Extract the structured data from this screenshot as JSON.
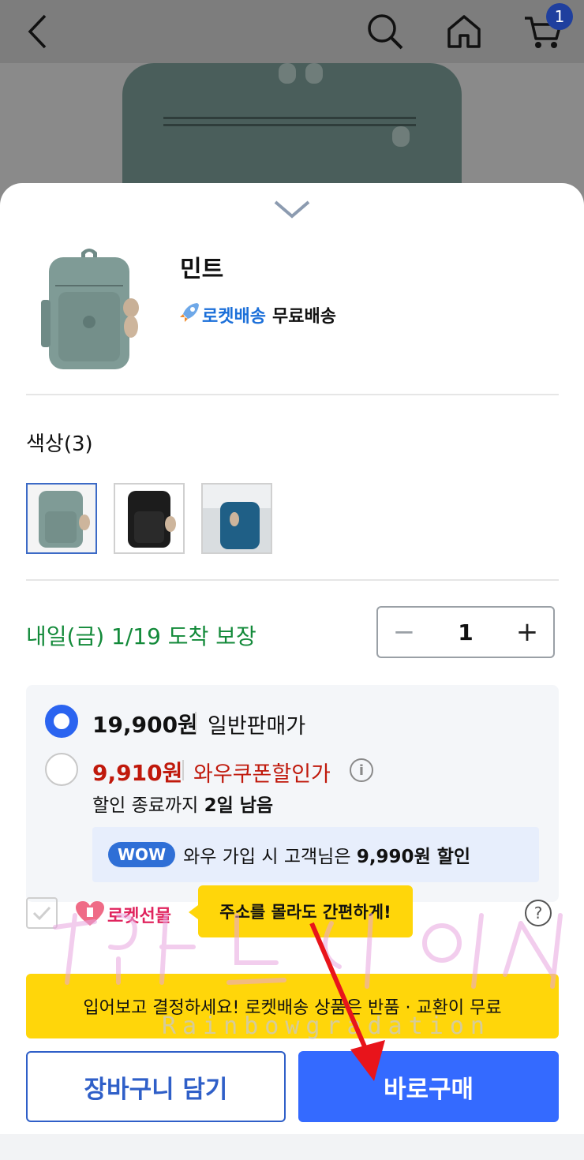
{
  "header": {
    "back_icon": "chevron-left-icon",
    "search_icon": "search-icon",
    "home_icon": "home-icon",
    "cart_icon": "cart-icon",
    "cart_count": "1"
  },
  "product": {
    "option_name": "민트",
    "rocket_label": "로켓배송",
    "shipping_text": "무료배송"
  },
  "color": {
    "title": "색상(3)",
    "swatches": [
      {
        "name": "mint",
        "color": "#7f9b96"
      },
      {
        "name": "black",
        "color": "#1c1c1c"
      },
      {
        "name": "blue",
        "color": "#1f5f86"
      }
    ]
  },
  "delivery": {
    "arrival_text": "내일(금) 1/19 도착 보장"
  },
  "quantity": {
    "value": "1",
    "minus": "−",
    "plus": "+"
  },
  "prices": {
    "regular_price": "19,900원",
    "regular_label": "일반판매가",
    "coupon_price": "9,910원",
    "coupon_label": "와우쿠폰할인가",
    "info": "i",
    "deadline_prefix": "할인 종료까지 ",
    "deadline_value": "2일 남음",
    "wow_badge": "WOW",
    "wow_text_prefix": "와우 가입 시 고객님은 ",
    "wow_text_value": "9,990원 할인"
  },
  "gift": {
    "label": "로켓선물",
    "tooltip": "주소를 몰라도 간편하게!",
    "help": "?"
  },
  "banner": {
    "text": "입어보고 결정하세요! 로켓배송 상품은 반품 · 교환이 무료"
  },
  "actions": {
    "cart_button": "장바구니 담기",
    "buy_button": "바로구매"
  },
  "watermark": {
    "text": "Rainbowgradation"
  },
  "colors": {
    "accent_blue": "#346aff",
    "coupon_red": "#c0190c",
    "arrival_green": "#138a3a",
    "tooltip_yellow": "#ffd60a"
  }
}
